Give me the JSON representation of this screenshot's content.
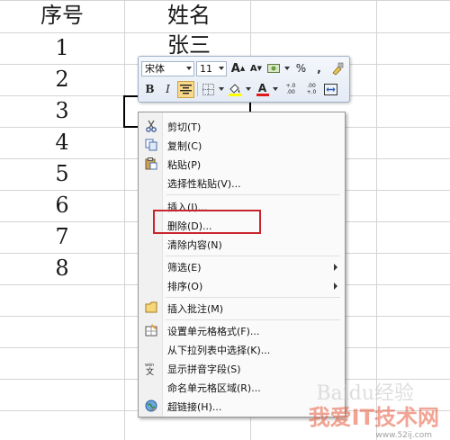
{
  "sheet": {
    "headers": [
      "序号",
      "姓名"
    ],
    "col_a": [
      "1",
      "2",
      "3",
      "4",
      "5",
      "6",
      "7",
      "8"
    ],
    "b1": "张三"
  },
  "mini_toolbar": {
    "font_name": "宋体",
    "font_size": "11",
    "grow_font": "A",
    "shrink_font": "A",
    "percent": "%",
    "comma": ",",
    "bold": "B",
    "italic": "I",
    "font_color_letter": "A",
    "increase_decimal": "+.0 .00",
    "decrease_decimal": ".00 +.0"
  },
  "context_menu": {
    "items": [
      {
        "label": "剪切(T)",
        "icon": "scissors-icon"
      },
      {
        "label": "复制(C)",
        "icon": "copy-icon"
      },
      {
        "label": "粘贴(P)",
        "icon": "paste-icon"
      },
      {
        "label": "选择性粘贴(V)..."
      },
      {
        "label": "插入(I)..."
      },
      {
        "label": "删除(D)..."
      },
      {
        "label": "清除内容(N)"
      },
      {
        "label": "筛选(E)",
        "submenu": true
      },
      {
        "label": "排序(O)",
        "submenu": true
      },
      {
        "label": "插入批注(M)",
        "icon": "comment-icon"
      },
      {
        "label": "设置单元格格式(F)...",
        "icon": "format-cells-icon"
      },
      {
        "label": "从下拉列表中选择(K)..."
      },
      {
        "label": "显示拼音字段(S)",
        "icon": "phonetic-icon"
      },
      {
        "label": "命名单元格区域(R)..."
      },
      {
        "label": "超链接(H)...",
        "icon": "hyperlink-icon"
      }
    ]
  },
  "watermark": {
    "text": "我爱IT技术网",
    "url": "www.52ij.com",
    "baidu": "Baidu经验"
  }
}
